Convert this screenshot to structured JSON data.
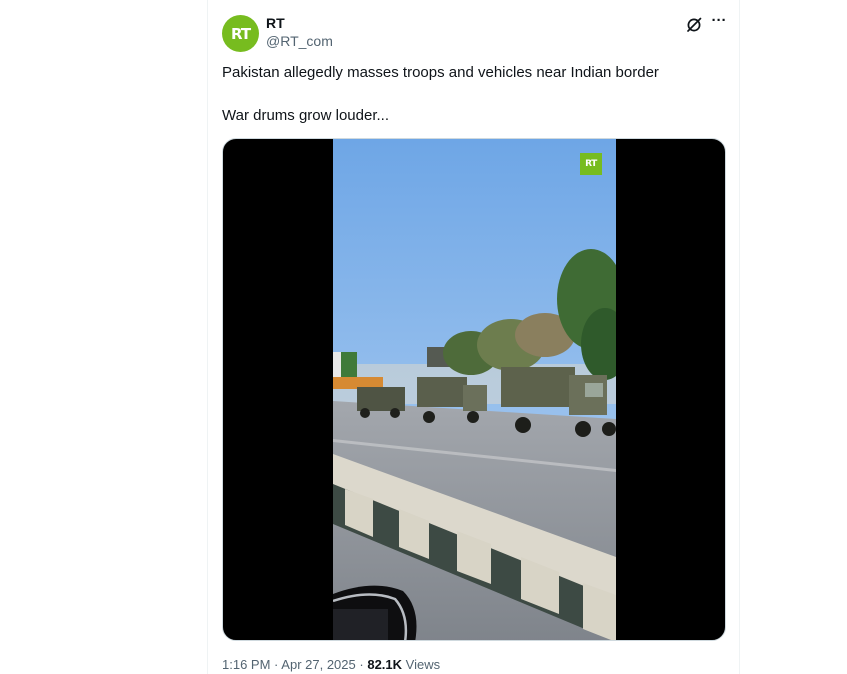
{
  "tweet": {
    "author": {
      "avatar_text": "RT",
      "display_name": "RT",
      "handle": "@RT_com"
    },
    "text_line1": "Pakistan allegedly masses troops and vehicles near Indian border",
    "text_line2": "War drums grow louder...",
    "media": {
      "type": "video",
      "watermark_text": "RT"
    },
    "time": "1:16 PM",
    "separator": "·",
    "date": "Apr 27, 2025",
    "views_count": "82.1K",
    "views_label": "Views"
  },
  "icons": {
    "grok": "grok-icon",
    "more": "more-icon"
  },
  "colors": {
    "brand_green": "#77bc1f",
    "text_primary": "#0f1419",
    "text_secondary": "#536471",
    "border": "#cfd9de"
  }
}
